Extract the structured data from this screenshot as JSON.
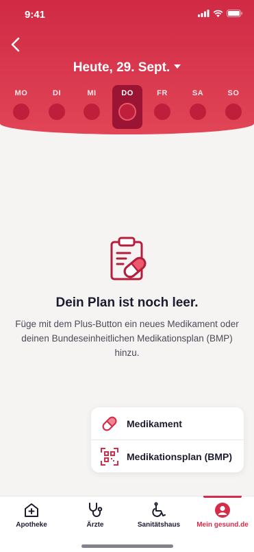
{
  "status_bar": {
    "time": "9:41"
  },
  "header": {
    "date_label": "Heute, 29. Sept."
  },
  "week": [
    {
      "label": "MO",
      "active": false
    },
    {
      "label": "DI",
      "active": false
    },
    {
      "label": "MI",
      "active": false
    },
    {
      "label": "DO",
      "active": true
    },
    {
      "label": "FR",
      "active": false
    },
    {
      "label": "SA",
      "active": false
    },
    {
      "label": "SO",
      "active": false
    }
  ],
  "empty_state": {
    "title": "Dein Plan ist noch leer.",
    "description": "Füge mit dem Plus-Button ein neues Medikament oder deinen Bundeseinheitlichen Medikationsplan (BMP) hinzu."
  },
  "add_menu": {
    "items": [
      {
        "label": "Medikament",
        "icon": "pill-icon"
      },
      {
        "label": "Medikationsplan (BMP)",
        "icon": "qr-code-icon"
      }
    ]
  },
  "tabbar": {
    "tabs": [
      {
        "label": "Apotheke",
        "icon": "pharmacy-icon",
        "active": false
      },
      {
        "label": "Ärzte",
        "icon": "stethoscope-icon",
        "active": false
      },
      {
        "label": "Sanitätshaus",
        "icon": "wheelchair-icon",
        "active": false
      },
      {
        "label": "Mein gesund.de",
        "icon": "profile-icon",
        "active": true
      }
    ]
  },
  "colors": {
    "accent": "#d42d49",
    "header": "#d83348",
    "active_day": "#9b1433",
    "text": "#1b1b2e"
  }
}
